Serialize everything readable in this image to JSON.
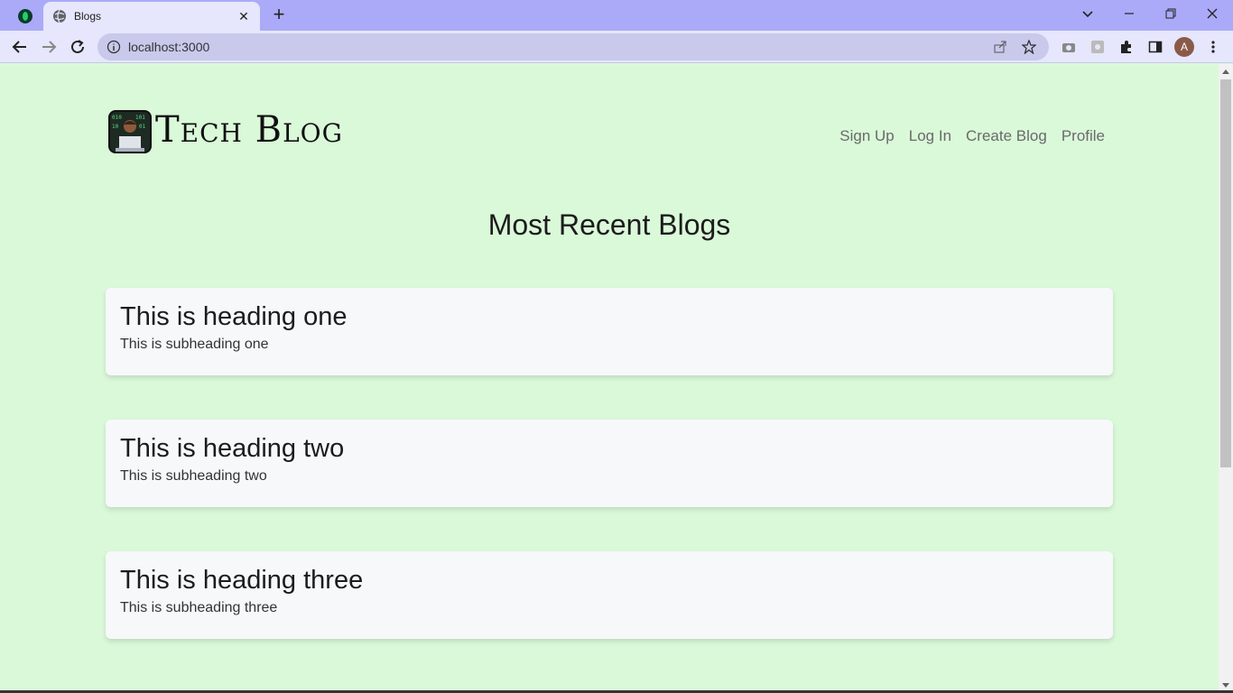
{
  "browser": {
    "tab_title": "Blogs",
    "url": "localhost:3000",
    "profile_initial": "A"
  },
  "site": {
    "title": "Tech Blog",
    "nav": [
      "Sign Up",
      "Log In",
      "Create Blog",
      "Profile"
    ]
  },
  "main": {
    "heading": "Most Recent Blogs",
    "posts": [
      {
        "title": "This is heading one",
        "subtitle": "This is subheading one"
      },
      {
        "title": "This is heading two",
        "subtitle": "This is subheading two"
      },
      {
        "title": "This is heading three",
        "subtitle": "This is subheading three"
      }
    ]
  },
  "colors": {
    "page_background": "#daf9d9",
    "card_background": "#f7f8fa",
    "tabstrip": "#aaaaf8"
  }
}
